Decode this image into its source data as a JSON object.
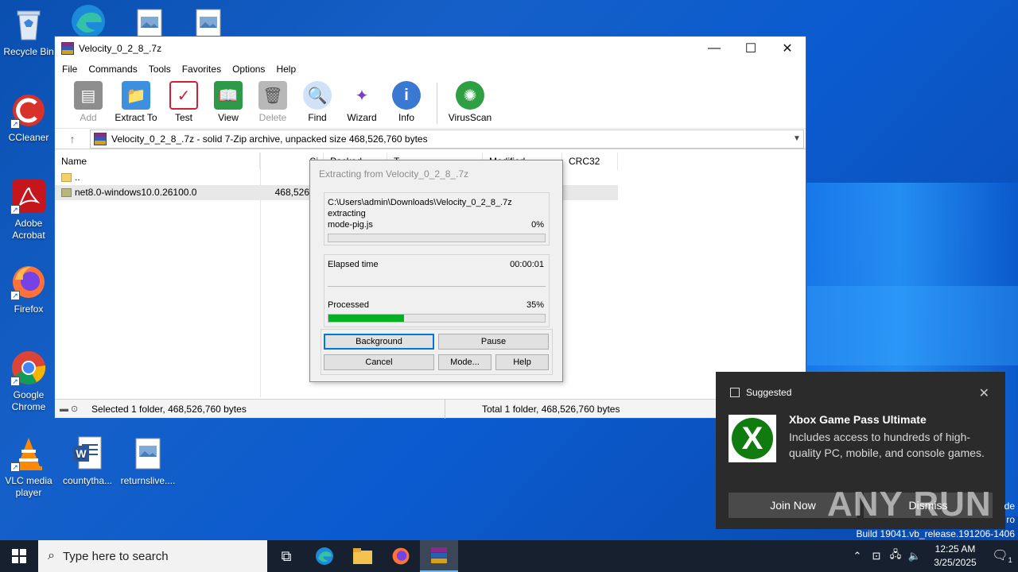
{
  "desktop": {
    "icons": [
      {
        "label": "Recycle Bin"
      },
      {
        "label": "CCleaner"
      },
      {
        "label": "Adobe Acrobat"
      },
      {
        "label": "Firefox"
      },
      {
        "label": "Google Chrome"
      },
      {
        "label": "VLC media player"
      },
      {
        "label": "countytha..."
      },
      {
        "label": "returnslive...."
      }
    ],
    "build_text": "Build 19041.vb_release.191206-1406",
    "edge_text_1": "de",
    "edge_text_2": "ro",
    "watermark": "ANY RUN"
  },
  "winrar": {
    "title": "Velocity_0_2_8_.7z",
    "menu": [
      "File",
      "Commands",
      "Tools",
      "Favorites",
      "Options",
      "Help"
    ],
    "toolbar": [
      {
        "label": "Add",
        "icon": "add-icon",
        "disabled": true
      },
      {
        "label": "Extract To",
        "icon": "extract-icon",
        "disabled": false
      },
      {
        "label": "Test",
        "icon": "test-icon",
        "disabled": false
      },
      {
        "label": "View",
        "icon": "view-icon",
        "disabled": false
      },
      {
        "label": "Delete",
        "icon": "delete-icon",
        "disabled": true
      },
      {
        "label": "Find",
        "icon": "find-icon",
        "disabled": false
      },
      {
        "label": "Wizard",
        "icon": "wizard-icon",
        "disabled": false
      },
      {
        "label": "Info",
        "icon": "info-icon",
        "disabled": false
      },
      {
        "label": "VirusScan",
        "icon": "virusscan-icon",
        "disabled": false
      }
    ],
    "address": "Velocity_0_2_8_.7z - solid 7-Zip archive, unpacked size 468,526,760 bytes",
    "columns": {
      "name": "Name",
      "size": "Si",
      "packed": "Packed",
      "type": "T",
      "modified": "Modified",
      "crc": "CRC32"
    },
    "rows": [
      {
        "name": "..",
        "size": ""
      },
      {
        "name": "net8.0-windows10.0.26100.0",
        "size": "468,526,7"
      }
    ],
    "status_left": "Selected 1 folder, 468,526,760 bytes",
    "status_right": "Total 1 folder, 468,526,760 bytes"
  },
  "dialog": {
    "title": "Extracting from Velocity_0_2_8_.7z",
    "path": "C:\\Users\\admin\\Downloads\\Velocity_0_2_8_.7z",
    "action": "extracting",
    "file": "mode-pig.js",
    "file_percent": "0%",
    "file_progress": 0,
    "elapsed_label": "Elapsed time",
    "elapsed_value": "00:00:01",
    "processed_label": "Processed",
    "processed_percent": "35%",
    "processed_progress": 0.35,
    "buttons": {
      "background": "Background",
      "pause": "Pause",
      "cancel": "Cancel",
      "mode": "Mode...",
      "help": "Help"
    }
  },
  "toast": {
    "header": "Suggested",
    "title": "Xbox Game Pass Ultimate",
    "body": "Includes access to hundreds of high-quality PC, mobile, and console games.",
    "join": "Join Now",
    "dismiss": "Dismiss"
  },
  "taskbar": {
    "search_placeholder": "Type here to search",
    "time": "12:25 AM",
    "date": "3/25/2025",
    "notification_count": "1"
  },
  "colors": {
    "accent": "#0078d7",
    "progress": "#06b025",
    "taskbar": "#17202e",
    "xbox": "#107c10"
  }
}
